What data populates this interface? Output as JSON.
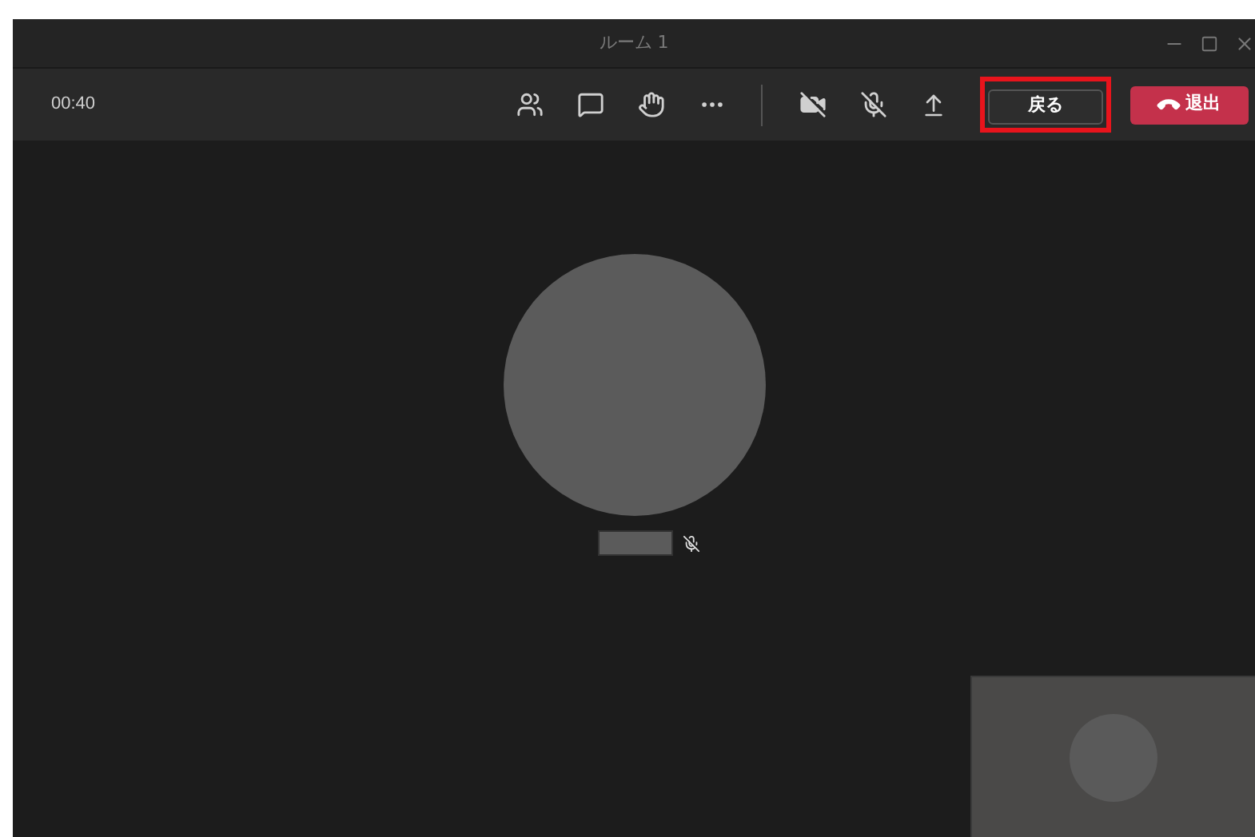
{
  "window": {
    "title": "ルーム 1"
  },
  "toolbar": {
    "timer": "00:40",
    "back_button": {
      "label": "戻る",
      "highlighted": true
    },
    "leave_button": {
      "label": "退出"
    }
  },
  "participant": {
    "muted": true
  },
  "self_view": {
    "kind": "avatar"
  }
}
